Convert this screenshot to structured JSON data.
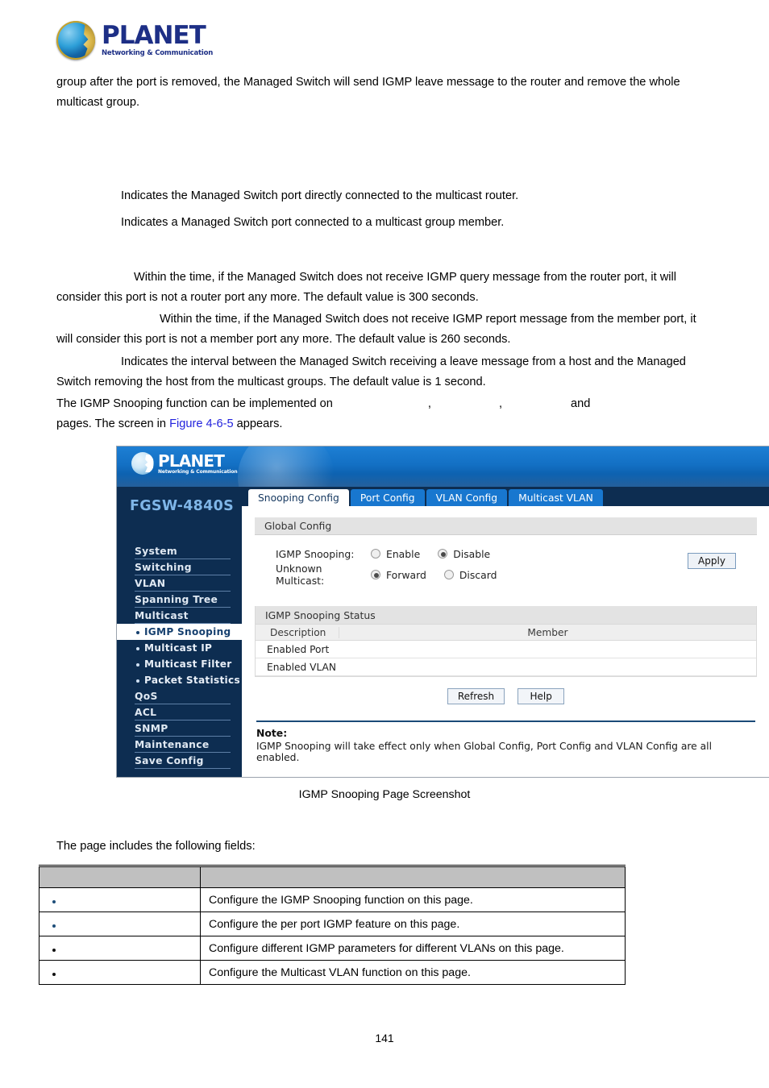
{
  "brand": {
    "name": "PLANET",
    "tagline": "Networking & Communication"
  },
  "document": {
    "paragraph_intro": "group after the port is removed, the Managed Switch will send IGMP leave message to the router and remove the whole multicast group.",
    "router_port_desc": "Indicates the Managed Switch port directly connected to the multicast router.",
    "member_port_desc": "Indicates a Managed Switch port connected to a multicast group member.",
    "router_time_desc": "Within the time, if the Managed Switch does not receive IGMP query message from the router port, it will consider this port is not a router port any more. The default value is 300 seconds.",
    "member_time_desc": "Within the time, if the Managed Switch does not receive IGMP report message from the member port, it will consider this port is not a member port any more. The default value is 260 seconds.",
    "leave_time_desc": "Indicates the interval between the Managed Switch receiving a leave message from a host and the Managed Switch removing the host from the multicast groups. The default value is 1 second.",
    "implemented_lead": "The IGMP Snooping function can be implemented on",
    "implemented_comma_1": ",",
    "implemented_comma_2": ",",
    "implemented_and": "and",
    "implemented_tail_1": "pages. The screen in",
    "figure_link": "Figure 4-6-5",
    "implemented_tail_2": "appears.",
    "fields_intro": "The page includes the following fields:",
    "caption": "IGMP Snooping Page Screenshot",
    "page_number": "141"
  },
  "switch_ui": {
    "model": "FGSW-4840S",
    "sidebar": [
      {
        "label": "System",
        "type": "top",
        "active": false
      },
      {
        "label": "Switching",
        "type": "top",
        "active": false
      },
      {
        "label": "VLAN",
        "type": "top",
        "active": false
      },
      {
        "label": "Spanning Tree",
        "type": "top",
        "active": false
      },
      {
        "label": "Multicast",
        "type": "top",
        "active": false
      },
      {
        "label": "IGMP Snooping",
        "type": "sub",
        "active": true
      },
      {
        "label": "Multicast IP",
        "type": "sub",
        "active": false
      },
      {
        "label": "Multicast Filter",
        "type": "sub",
        "active": false
      },
      {
        "label": "Packet Statistics",
        "type": "sub",
        "active": false
      },
      {
        "label": "QoS",
        "type": "top",
        "active": false
      },
      {
        "label": "ACL",
        "type": "top",
        "active": false
      },
      {
        "label": "SNMP",
        "type": "top",
        "active": false
      },
      {
        "label": "Maintenance",
        "type": "top",
        "active": false
      },
      {
        "label": "Save Config",
        "type": "top",
        "active": false
      }
    ],
    "tabs": [
      {
        "label": "Snooping Config",
        "active": true
      },
      {
        "label": "Port Config",
        "active": false
      },
      {
        "label": "VLAN Config",
        "active": false
      },
      {
        "label": "Multicast VLAN",
        "active": false
      }
    ],
    "global_config": {
      "title": "Global Config",
      "igmp_snooping_label": "IGMP Snooping:",
      "igmp_enable": "Enable",
      "igmp_disable": "Disable",
      "igmp_selected": "Disable",
      "unknown_multicast_label": "Unknown Multicast:",
      "unknown_forward": "Forward",
      "unknown_discard": "Discard",
      "unknown_selected": "Forward",
      "apply_label": "Apply"
    },
    "status": {
      "title": "IGMP Snooping Status",
      "col_description": "Description",
      "col_member": "Member",
      "rows": [
        {
          "description": "Enabled Port",
          "member": ""
        },
        {
          "description": "Enabled VLAN",
          "member": ""
        }
      ],
      "refresh_label": "Refresh",
      "help_label": "Help"
    },
    "note": {
      "title": "Note:",
      "text": "IGMP Snooping will take effect only when Global Config, Port Config and VLAN Config are all enabled."
    },
    "colors": {
      "sidebar_bg": "#0d2d51",
      "banner_blue": "#1370c4",
      "tab_blue": "#1877cf",
      "active_label": "#16406f",
      "model_text": "#7fb6e8"
    }
  },
  "field_table": {
    "header": {
      "col1": "",
      "col2": ""
    },
    "rows": [
      {
        "label": "",
        "bullet": "blue",
        "description": "Configure the IGMP Snooping function on this page."
      },
      {
        "label": "",
        "bullet": "blue",
        "description": "Configure the per port IGMP feature on this page."
      },
      {
        "label": "",
        "bullet": "dark",
        "description": "Configure different IGMP parameters for different VLANs on this page."
      },
      {
        "label": "",
        "bullet": "dark",
        "description": "Configure the Multicast VLAN function on this page."
      }
    ]
  }
}
